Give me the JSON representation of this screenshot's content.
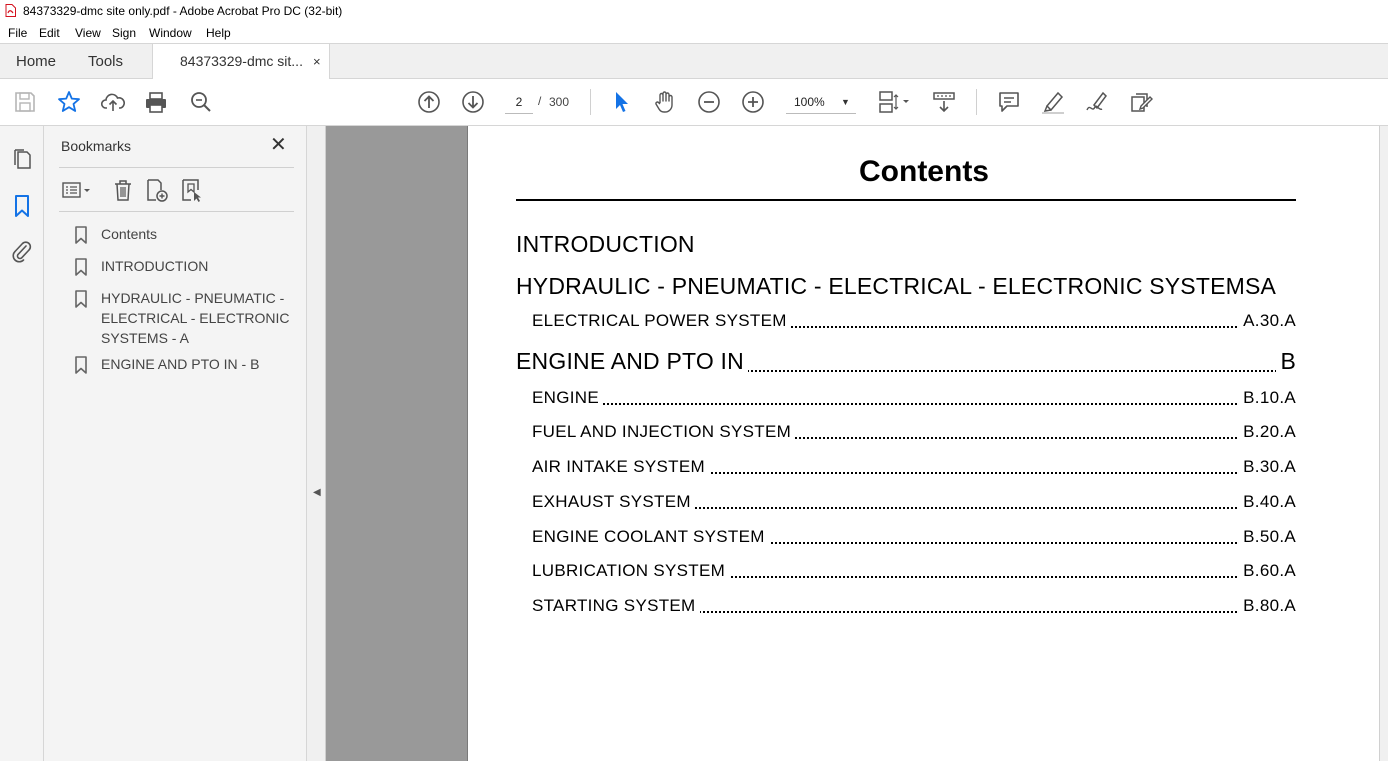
{
  "window": {
    "title": "84373329-dmc site only.pdf - Adobe Acrobat Pro DC (32-bit)"
  },
  "menu": [
    "File",
    "Edit",
    "View",
    "Sign",
    "Window",
    "Help"
  ],
  "tabs": {
    "home": "Home",
    "tools": "Tools",
    "document": "84373329-dmc sit...",
    "close_glyph": "×"
  },
  "toolbar": {
    "current_page": "2",
    "page_separator": "/",
    "total_pages": "300",
    "zoom": "100%"
  },
  "bookmarks": {
    "title": "Bookmarks",
    "close_glyph": "✕",
    "items": [
      {
        "label": "Contents"
      },
      {
        "label": "INTRODUCTION"
      },
      {
        "label": "HYDRAULIC - PNEUMATIC - ELECTRICAL - ELECTRONIC SYSTEMS - A"
      },
      {
        "label": "ENGINE AND PTO IN - B"
      }
    ]
  },
  "document": {
    "heading": "Contents",
    "toc": [
      {
        "name": "INTRODUCTION",
        "ref": "",
        "leader": false
      },
      {
        "name": "HYDRAULIC - PNEUMATIC - ELECTRICAL - ELECTRONIC SYSTEMSA",
        "ref": "",
        "leader": false
      },
      {
        "name": "ELECTRICAL POWER SYSTEM",
        "ref": "A.30.A",
        "leader": true
      },
      {
        "name": "ENGINE AND PTO IN",
        "ref": "B",
        "leader": true
      },
      {
        "name": "ENGINE",
        "ref": "B.10.A",
        "leader": true
      },
      {
        "name": "FUEL AND INJECTION SYSTEM",
        "ref": "B.20.A",
        "leader": true
      },
      {
        "name": "AIR INTAKE SYSTEM",
        "ref": "B.30.A",
        "leader": true
      },
      {
        "name": "EXHAUST SYSTEM",
        "ref": "B.40.A",
        "leader": true
      },
      {
        "name": "ENGINE COOLANT SYSTEM",
        "ref": "B.50.A",
        "leader": true
      },
      {
        "name": "LUBRICATION SYSTEM",
        "ref": "B.60.A",
        "leader": true
      },
      {
        "name": "STARTING SYSTEM",
        "ref": "B.80.A",
        "leader": true
      }
    ]
  },
  "colors": {
    "accent": "#1473e6",
    "pdf_red": "#d4111e",
    "doc_background": "#999999"
  }
}
